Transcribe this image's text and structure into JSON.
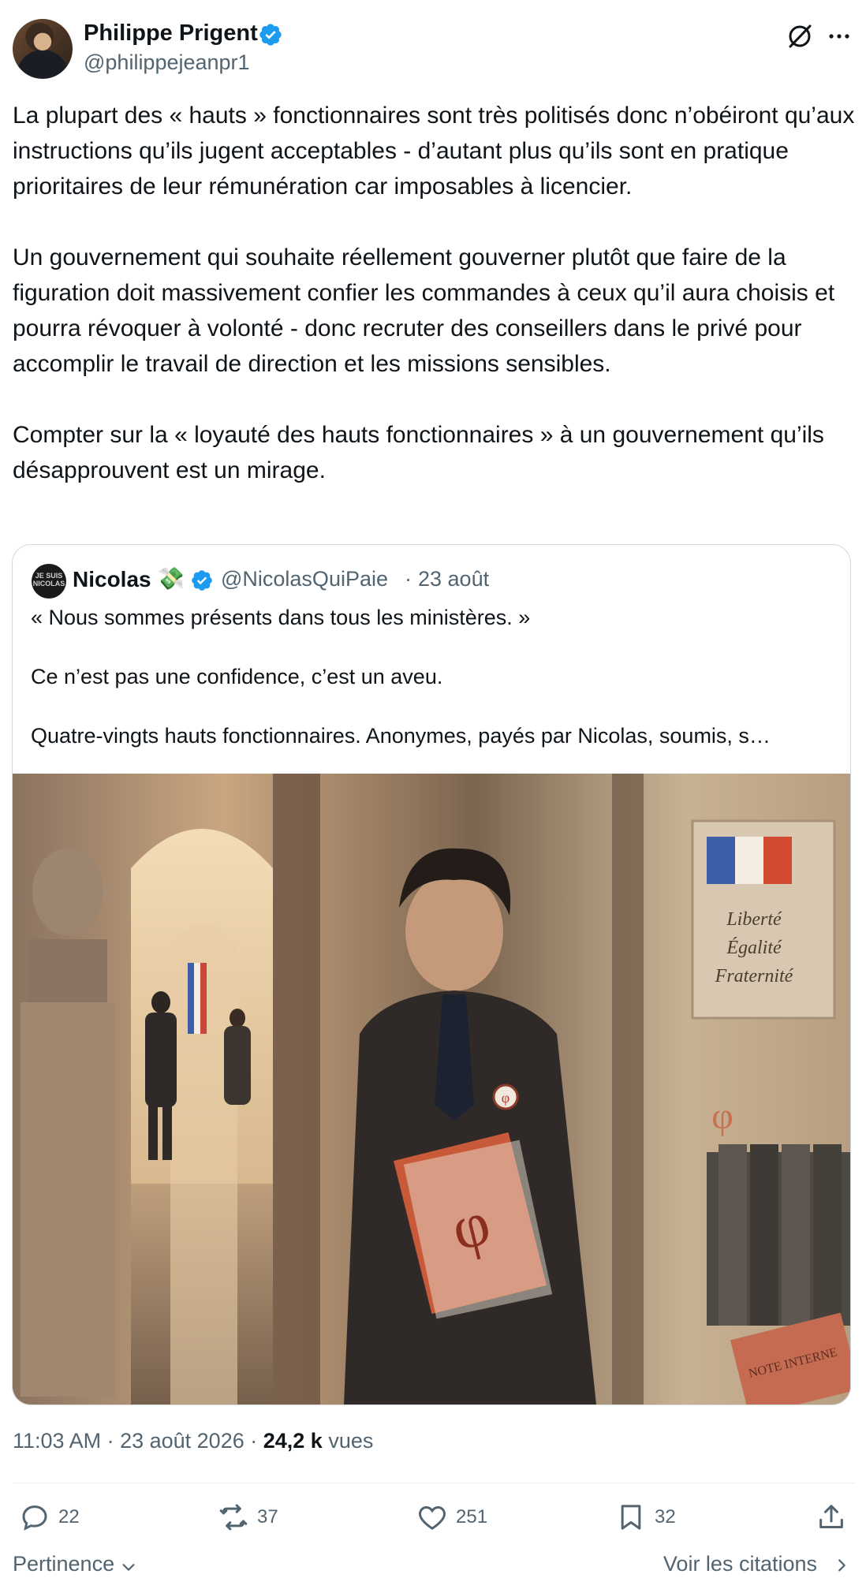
{
  "author": {
    "name": "Philippe Prigent",
    "handle": "@philippejeanpr1"
  },
  "tweet": {
    "text": "La plupart des « hauts » fonctionnaires sont très politisés donc n’obéiront qu’aux instructions qu’ils jugent acceptables - d’autant plus qu’ils sont en pratique prioritaires de leur rémunération car imposables à licencier.\n\nUn gouvernement qui souhaite réellement gouverner plutôt que faire de la figuration doit massivement confier les commandes à ceux qu’il aura choisis et pourra révoquer à volonté - donc recruter des conseillers dans le privé pour accomplir le travail de direction et les missions sensibles.\n\nCompter sur la « loyauté des hauts fonctionnaires » à un gouvernement qu’ils désapprouvent est un mirage."
  },
  "quote": {
    "avatar_text": "JE SUIS NICOLAS",
    "name": "Nicolas",
    "emoji": "💸",
    "handle": "@NicolasQuiPaie",
    "separator": "·",
    "date": "23 août",
    "text": "« Nous sommes présents dans tous les ministères. »\n\nCe n’est pas une confidence, c’est un aveu.\n\nQuatre-vingts hauts fonctionnaires. Anonymes, payés par Nicolas, soumis, s…",
    "image": {
      "sign_lines": [
        "Liberté",
        "Égalité",
        "Fraternité"
      ],
      "folder_label": "NOTE INTERNE"
    }
  },
  "meta": {
    "time": "11:03 AM",
    "sep1": " · ",
    "date": "23 août 2026",
    "sep2": " · ",
    "views_count": "24,2 k",
    "views_label": " vues"
  },
  "actions": {
    "replies": "22",
    "retweets": "37",
    "likes": "251",
    "bookmarks": "32"
  },
  "footer": {
    "sort_label": "Pertinence",
    "citations_label": "Voir les citations"
  },
  "colors": {
    "text": "#0f1419",
    "secondary": "#536471",
    "verified": "#1d9bf0",
    "border": "#cfd9de"
  },
  "icons": [
    "verified-icon",
    "grok-icon",
    "more-icon",
    "reply-icon",
    "retweet-icon",
    "like-icon",
    "bookmark-icon",
    "share-icon",
    "chevron-down-icon",
    "chevron-right-icon"
  ]
}
